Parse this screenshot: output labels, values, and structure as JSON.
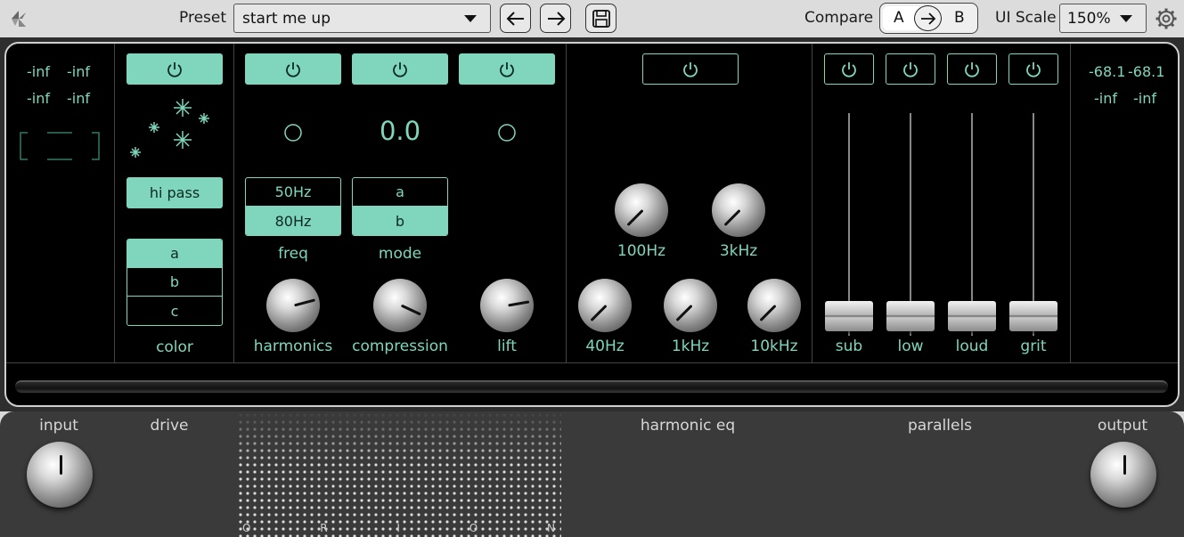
{
  "toolbar": {
    "preset_label": "Preset",
    "preset_value": "start me up",
    "compare_label": "Compare",
    "compare_a": "A",
    "compare_b": "B",
    "ui_scale_label": "UI Scale",
    "ui_scale_value": "150%"
  },
  "input_meter": {
    "l_peak": "-inf",
    "r_peak": "-inf",
    "l_rms": "-inf",
    "r_rms": "-inf"
  },
  "output_meter": {
    "l_peak": "-68.1",
    "r_peak": "-68.1",
    "l_rms": "-inf",
    "r_rms": "-inf"
  },
  "color_section": {
    "filter_label": "hi pass",
    "options": [
      "a",
      "b",
      "c"
    ],
    "selected": "a",
    "label": "color"
  },
  "drive_section": {
    "display_value": "0.0",
    "freq_options": [
      "50Hz",
      "80Hz"
    ],
    "freq_selected": "80Hz",
    "freq_label": "freq",
    "mode_options": [
      "a",
      "b"
    ],
    "mode_selected": "b",
    "mode_label": "mode",
    "knobs": [
      {
        "label": "harmonics"
      },
      {
        "label": "compression"
      },
      {
        "label": "lift"
      }
    ]
  },
  "eq_section": {
    "knobs": [
      {
        "label": "100Hz"
      },
      {
        "label": "3kHz"
      },
      {
        "label": "40Hz"
      },
      {
        "label": "1kHz"
      },
      {
        "label": "10kHz"
      }
    ]
  },
  "parallels_section": {
    "faders": [
      {
        "label": "sub"
      },
      {
        "label": "low"
      },
      {
        "label": "loud"
      },
      {
        "label": "grit"
      }
    ]
  },
  "chassis": {
    "input_label": "input",
    "drive_label": "drive",
    "eq_label": "harmonic eq",
    "parallels_label": "parallels",
    "output_label": "output",
    "brand_letters": [
      "O",
      "R",
      "I",
      "O",
      "N"
    ]
  },
  "colors": {
    "accent": "#7fd6bc",
    "panel": "#000000",
    "chassis": "#3a3a3a"
  }
}
